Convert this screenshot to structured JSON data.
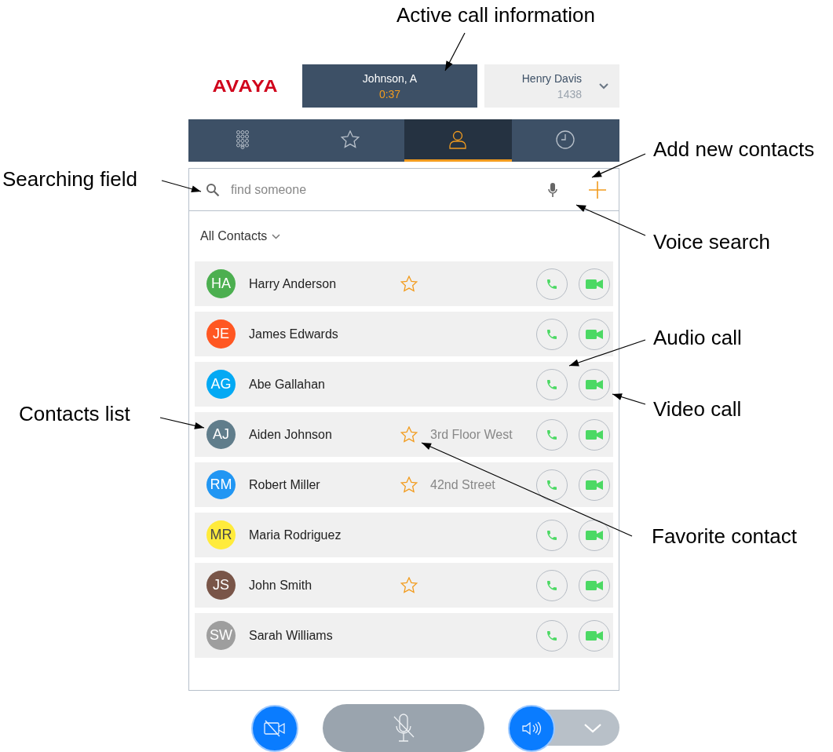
{
  "annotations": [
    {
      "text": "Active call information"
    },
    {
      "text": "Add new contacts"
    },
    {
      "text": "Searching field"
    },
    {
      "text": "Voice search"
    },
    {
      "text": "Audio call"
    },
    {
      "text": "Video call"
    },
    {
      "text": "Contacts list"
    },
    {
      "text": "Favorite contact"
    }
  ],
  "logo": "AVAYA",
  "active_call": {
    "name": "Johnson, A",
    "duration": "0:37"
  },
  "line": {
    "name": "Henry Davis",
    "extension": "1438"
  },
  "tabs": [
    {
      "kind": "dialpad",
      "selected": false
    },
    {
      "kind": "favorites",
      "selected": false
    },
    {
      "kind": "contacts",
      "selected": true
    },
    {
      "kind": "history",
      "selected": false
    }
  ],
  "search": {
    "placeholder": "find someone"
  },
  "filter": "All Contacts",
  "contacts": [
    {
      "initials": "HA",
      "name": "Harry Anderson",
      "color": "#4caf50",
      "favorite": true
    },
    {
      "initials": "JE",
      "name": "James Edwards",
      "color": "#ff5722",
      "favorite": false
    },
    {
      "initials": "AG",
      "name": "Abe Gallahan",
      "color": "#03a9f4",
      "favorite": false
    },
    {
      "initials": "AJ",
      "name": "Aiden Johnson",
      "color": "#607d8b",
      "favorite": true,
      "location": "3rd Floor West"
    },
    {
      "initials": "RM",
      "name": "Robert Miller",
      "color": "#2196f3",
      "favorite": true,
      "location": "42nd Street"
    },
    {
      "initials": "MR",
      "name": "Maria Rodriguez",
      "color": "#ffeb3b",
      "favorite": false
    },
    {
      "initials": "JS",
      "name": "John Smith",
      "color": "#795548",
      "favorite": true
    },
    {
      "initials": "SW",
      "name": "Sarah Williams",
      "color": "#9e9e9e",
      "favorite": false
    }
  ]
}
